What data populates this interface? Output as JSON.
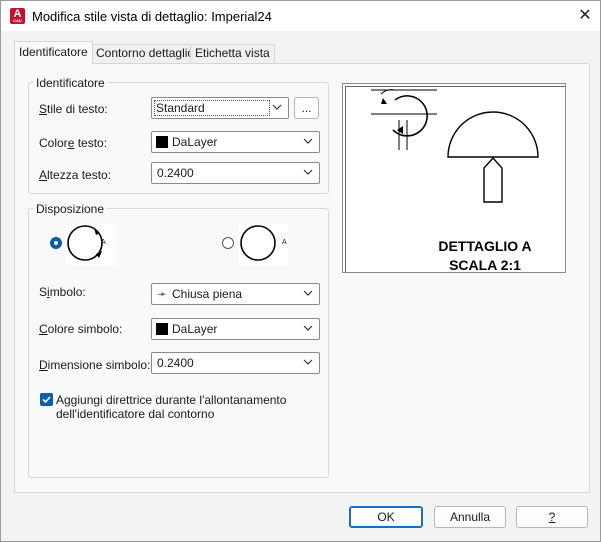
{
  "window": {
    "title": "Modifica stile vista di dettaglio: Imperial24",
    "app_icon_letter": "A",
    "app_icon_sub": "CAD",
    "close_symbol": "✕"
  },
  "tabs": [
    {
      "label": "Identificatore",
      "active": true
    },
    {
      "label": "Contorno dettaglio",
      "active": false
    },
    {
      "label": "Etichetta vista",
      "active": false
    }
  ],
  "identifier_group": {
    "title": "Identificatore",
    "text_style": {
      "label_prefix": "",
      "label_ul": "S",
      "label_rest": "tile di testo:",
      "value": "Standard",
      "browse_label": "..."
    },
    "text_color": {
      "label_prefix": "Color",
      "label_ul": "e",
      "label_rest": " testo:",
      "value": "DaLayer",
      "swatch_color": "#000000"
    },
    "text_height": {
      "label_prefix": "",
      "label_ul": "A",
      "label_rest": "ltezza testo:",
      "value": "0.2400"
    }
  },
  "layout_group": {
    "title": "Disposizione",
    "option1_selected": true,
    "option2_selected": false,
    "symbol_letter": "A",
    "symbol": {
      "label_prefix": "S",
      "label_ul": "i",
      "label_rest": "mbolo:",
      "value": "Chiusa piena",
      "arrow_glyph": "➛"
    },
    "symbol_color": {
      "label_prefix": "",
      "label_ul": "C",
      "label_rest": "olore simbolo:",
      "value": "DaLayer",
      "swatch_color": "#000000"
    },
    "symbol_size": {
      "label_prefix": "",
      "label_ul": "D",
      "label_rest": "imensione simbolo:",
      "value": "0.2400"
    },
    "leader_checkbox": {
      "checked": true,
      "line1": "Aggiungi direttrice durante l'allontanamento",
      "line2": "dell'identificatore dal contorno"
    }
  },
  "preview": {
    "line1": "DETTAGLIO A",
    "line2": "SCALA 2:1"
  },
  "footer": {
    "ok": "OK",
    "cancel": "Annulla",
    "help": "?"
  },
  "colors": {
    "accent": "#0b5cad",
    "brand": "#c8102e"
  }
}
